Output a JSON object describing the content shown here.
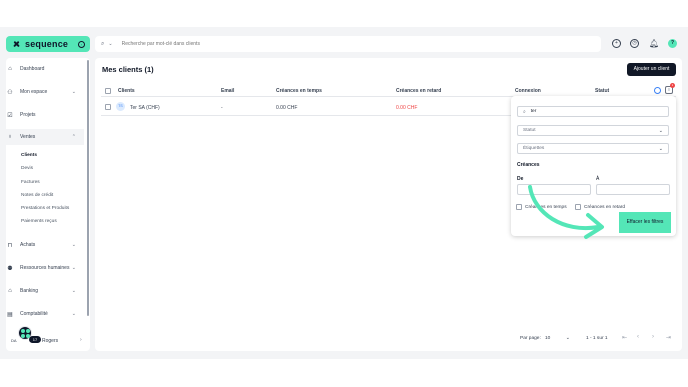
{
  "brand": {
    "name": "sequence",
    "accent": "#54e6b7"
  },
  "search": {
    "placeholder": "Recherche par mot-clé dans clients"
  },
  "topbar": {
    "icons": [
      "add-circle-icon",
      "history-icon",
      "bell-icon",
      "help-icon"
    ],
    "help_label": "?"
  },
  "sidebar": {
    "items": [
      {
        "label": "Dashboard",
        "icon": "home-icon"
      },
      {
        "label": "Mon espace",
        "icon": "user-icon"
      },
      {
        "label": "Projets",
        "icon": "checkbox-icon"
      },
      {
        "label": "Ventes",
        "icon": "money-bag-icon"
      },
      {
        "label": "Achats",
        "icon": "bag-icon"
      },
      {
        "label": "Ressources humaines",
        "icon": "people-icon"
      },
      {
        "label": "Banking",
        "icon": "bank-icon"
      },
      {
        "label": "Comptabilité",
        "icon": "ledger-icon"
      }
    ],
    "ventes_sub": [
      "Clients",
      "Devis",
      "Factures",
      "Notes de crédit",
      "Prestations et Produits",
      "Paiements reçus"
    ],
    "user": {
      "initials": "DA",
      "name": "Rogers",
      "badge": "17"
    }
  },
  "main": {
    "title": "Mes clients (1)",
    "add_button": "Ajouter un client",
    "columns": [
      "Clients",
      "Email",
      "Créances en temps",
      "Créances en retard",
      "Connexion",
      "Statut"
    ],
    "rows": [
      {
        "initials": "TS",
        "client": "Ter SA (CHF)",
        "email": "-",
        "on_time": "0.00 CHF",
        "late": "0.00 CHF"
      }
    ],
    "filter_count": "1"
  },
  "filter_panel": {
    "search_value": "ter",
    "statut_placeholder": "Statut",
    "etiquettes_placeholder": "Étiquettes",
    "creances_label": "Créances",
    "from_label": "De",
    "to_label": "À",
    "check_on_time": "Créances en temps",
    "check_late": "Créances en retard",
    "clear_button": "Effacer les filtres"
  },
  "pagination": {
    "per_page_label": "Par page:",
    "per_page_value": "10",
    "range": "1 - 1 sur 1"
  },
  "colors": {
    "late_amount": "#ef4444",
    "dark_button": "#111827"
  }
}
